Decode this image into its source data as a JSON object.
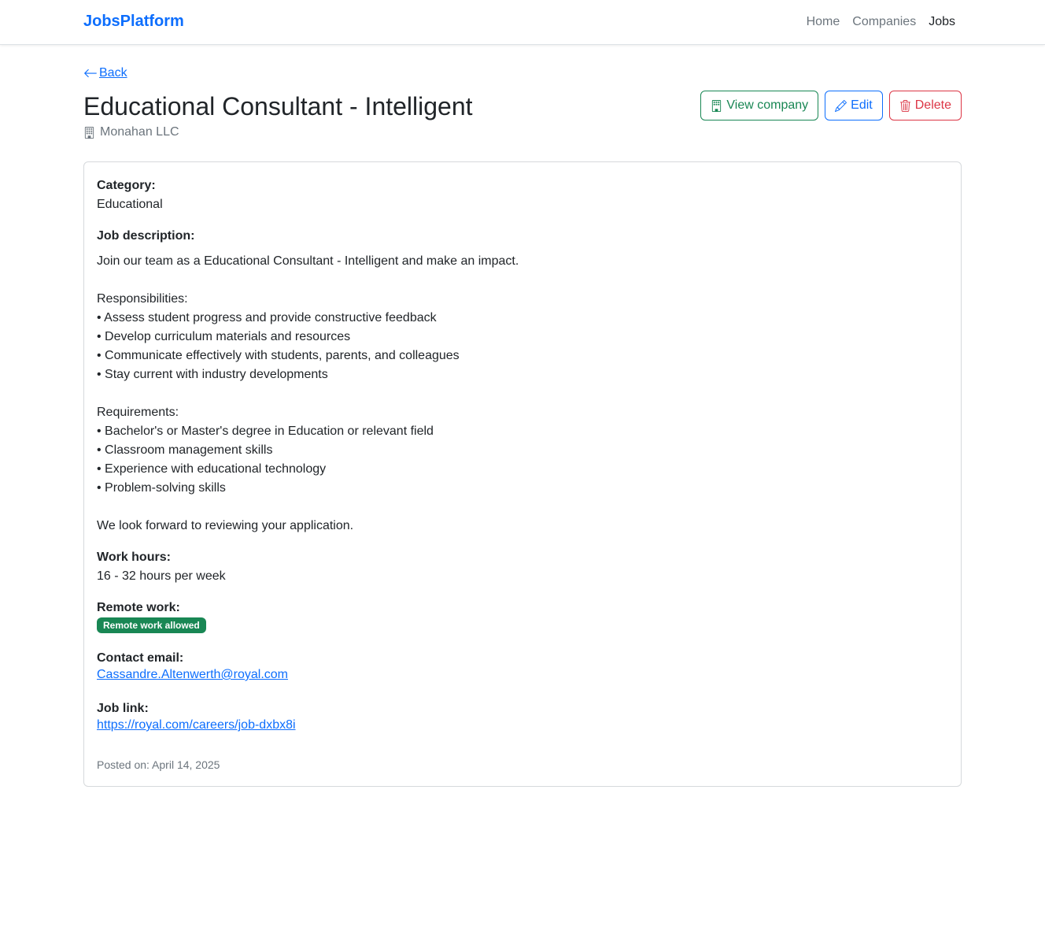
{
  "nav": {
    "brand": "JobsPlatform",
    "links": [
      "Home",
      "Companies",
      "Jobs"
    ]
  },
  "back_label": "Back",
  "job": {
    "title": "Educational Consultant - Intelligent",
    "company": "Monahan LLC"
  },
  "actions": {
    "view_company": "View company",
    "edit": "Edit",
    "delete": "Delete"
  },
  "details": {
    "category_label": "Category:",
    "category": "Educational",
    "description_label": "Job description:",
    "description": "Join our team as a Educational Consultant - Intelligent and make an impact.\n\nResponsibilities:\n• Assess student progress and provide constructive feedback\n• Develop curriculum materials and resources\n• Communicate effectively with students, parents, and colleagues\n• Stay current with industry developments\n\nRequirements:\n• Bachelor's or Master's degree in Education or relevant field\n• Classroom management skills\n• Experience with educational technology\n• Problem-solving skills\n\nWe look forward to reviewing your application.",
    "work_hours_label": "Work hours:",
    "work_hours": "16 - 32 hours per week",
    "remote_label": "Remote work:",
    "remote_badge": "Remote work allowed",
    "email_label": "Contact email:",
    "email": "Cassandre.Altenwerth@royal.com",
    "link_label": "Job link:",
    "link": "https://royal.com/careers/job-dxbx8i",
    "posted": "Posted on: April 14, 2025"
  },
  "colors": {
    "primary": "#0d6efd",
    "success": "#198754",
    "danger": "#dc3545",
    "muted": "#6c757d"
  }
}
